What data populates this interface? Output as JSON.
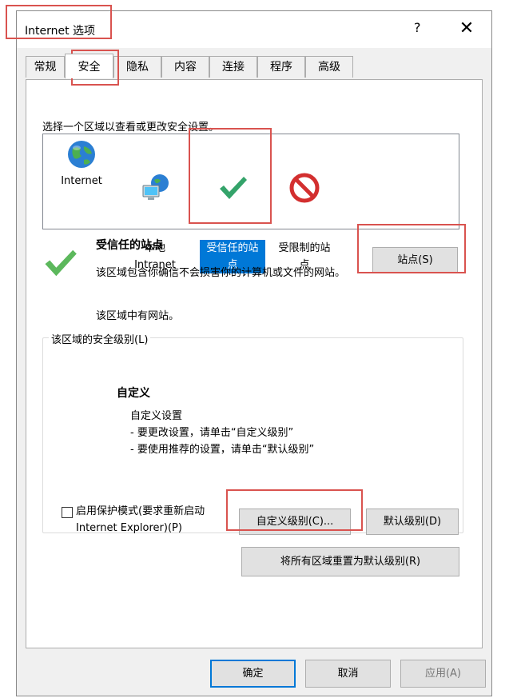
{
  "window": {
    "title": "Internet 选项",
    "help": "?",
    "close": "✕"
  },
  "tabs": [
    {
      "label": "常规"
    },
    {
      "label": "安全"
    },
    {
      "label": "隐私"
    },
    {
      "label": "内容"
    },
    {
      "label": "连接"
    },
    {
      "label": "程序"
    },
    {
      "label": "高级"
    }
  ],
  "zones_prompt": "选择一个区域以查看或更改安全设置。",
  "zones": [
    {
      "label": "Internet",
      "icon": "globe-icon"
    },
    {
      "label": "本地\nIntranet",
      "icon": "network-computer-icon"
    },
    {
      "label": "受信任的站\n点",
      "icon": "checkmark-icon",
      "selected": true
    },
    {
      "label": "受限制的站\n点",
      "icon": "restricted-icon"
    }
  ],
  "zone_info": {
    "title": "受信任的站点",
    "description": "该区域包含你确信不会损害你的计算机或文件的网站。",
    "sites_status": "该区域中有网站。",
    "sites_button": "站点(S)"
  },
  "security_level": {
    "legend": "该区域的安全级别(L)",
    "name": "自定义",
    "desc_lines": "自定义设置\n- 要更改设置，请单击“自定义级别”\n- 要使用推荐的设置，请单击“默认级别”"
  },
  "protected_mode": {
    "label": "启用保护模式(要求重新启动 Internet Explorer)(P)",
    "checked": false
  },
  "buttons": {
    "custom_level": "自定义级别(C)...",
    "default_level": "默认级别(D)",
    "reset_all": "将所有区域重置为默认级别(R)",
    "ok": "确定",
    "cancel": "取消",
    "apply": "应用(A)"
  },
  "colors": {
    "selection": "#0078d7",
    "highlight_box": "#d9534f"
  }
}
